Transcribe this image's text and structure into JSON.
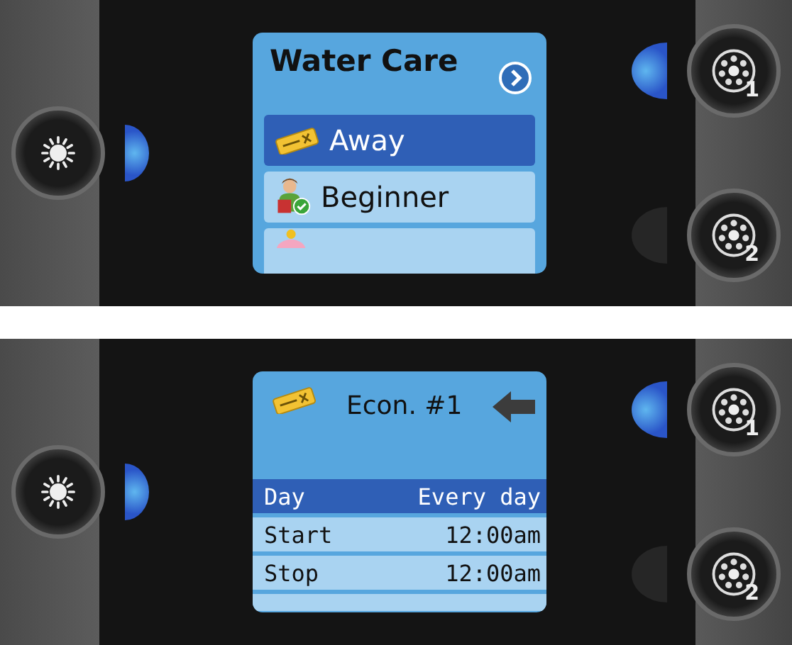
{
  "panels": [
    {
      "light_indicator_on": true,
      "screen": {
        "kind": "menu",
        "title": "Water Care",
        "items": [
          {
            "label": "Away",
            "kind": "ticket",
            "selected": true
          },
          {
            "label": "Beginner",
            "kind": "person",
            "selected": false
          },
          {
            "kind": "piggy",
            "selected": false
          }
        ]
      },
      "jets": [
        {
          "label": "1",
          "indicator_on": true
        },
        {
          "label": "2",
          "indicator_on": false
        }
      ]
    },
    {
      "light_indicator_on": true,
      "screen": {
        "kind": "settings",
        "title": "Econ. #1",
        "rows": [
          {
            "name": "Day",
            "value": "Every day",
            "selected": true
          },
          {
            "name": "Start",
            "value": "12:00am",
            "selected": false
          },
          {
            "name": "Stop",
            "value": "12:00am",
            "selected": false
          }
        ]
      },
      "jets": [
        {
          "label": "1",
          "indicator_on": true
        },
        {
          "label": "2",
          "indicator_on": false
        }
      ]
    }
  ]
}
